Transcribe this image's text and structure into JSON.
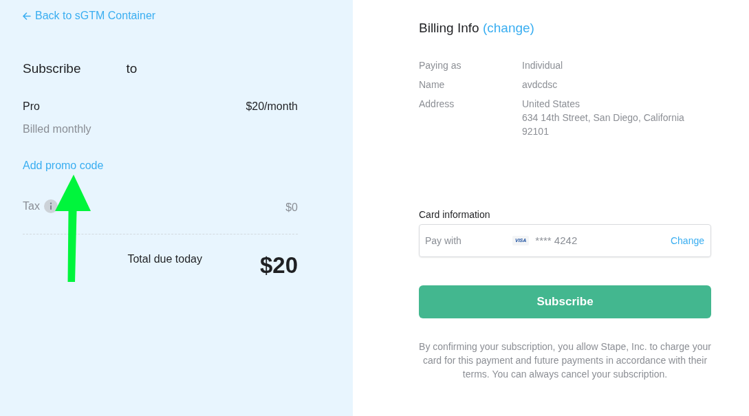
{
  "back_link": {
    "label": "Back to sGTM Container"
  },
  "order": {
    "heading": [
      "Subscribe",
      "to"
    ],
    "plan": {
      "name": "Pro",
      "price": "$20/month",
      "billing": "Billed monthly"
    },
    "promo_link": "Add promo code",
    "tax": {
      "label": "Tax",
      "amount": "$0"
    },
    "total": {
      "label": "Total due today",
      "amount": "$20"
    }
  },
  "billing": {
    "title": "Billing Info",
    "change_link": "(change)",
    "rows": [
      {
        "label": "Paying as",
        "lines": [
          "Individual"
        ]
      },
      {
        "label": "Name",
        "lines": [
          "avdcdsc"
        ]
      },
      {
        "label": "Address",
        "lines": [
          "United States",
          "634 14th Street, San Diego, California",
          "92101"
        ]
      }
    ]
  },
  "card": {
    "title": "Card information",
    "label": "Pay with",
    "brand": "VISA",
    "number": "**** 4242",
    "change_link": "Change"
  },
  "subscribe_button": "Subscribe",
  "disclaimer": "By confirming your subscription, you allow Stape, Inc. to charge your card for this payment and future payments in accordance with their terms. You can always cancel your subscription."
}
